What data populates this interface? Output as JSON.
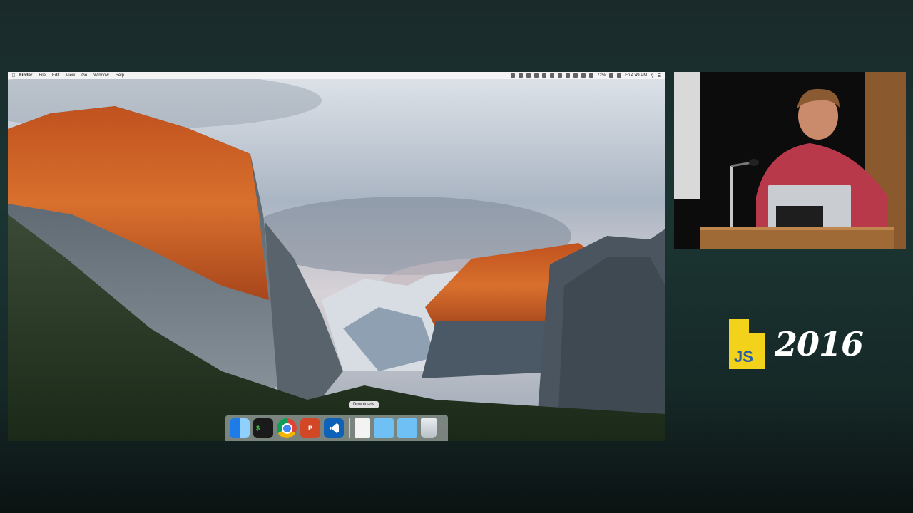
{
  "menubar": {
    "items": [
      "Finder",
      "File",
      "Edit",
      "View",
      "Go",
      "Window",
      "Help"
    ],
    "battery": "72%",
    "clock": "Fri 4:49 PM"
  },
  "dock": {
    "tooltip": "Downloads",
    "apps": [
      {
        "name": "finder-icon"
      },
      {
        "name": "terminal-icon",
        "glyph": "$"
      },
      {
        "name": "chrome-icon"
      },
      {
        "name": "powerpoint-icon",
        "glyph": "P"
      },
      {
        "name": "vscode-icon"
      },
      {
        "name": "document-icon"
      },
      {
        "name": "folder-icon"
      },
      {
        "name": "folder-icon"
      },
      {
        "name": "trash-icon"
      }
    ]
  },
  "branding": {
    "logo_letters": "JS",
    "year": "2016"
  },
  "colors": {
    "logo_yellow": "#F2D21B",
    "logo_text": "#2A5FA8",
    "background": "#1b3533"
  }
}
